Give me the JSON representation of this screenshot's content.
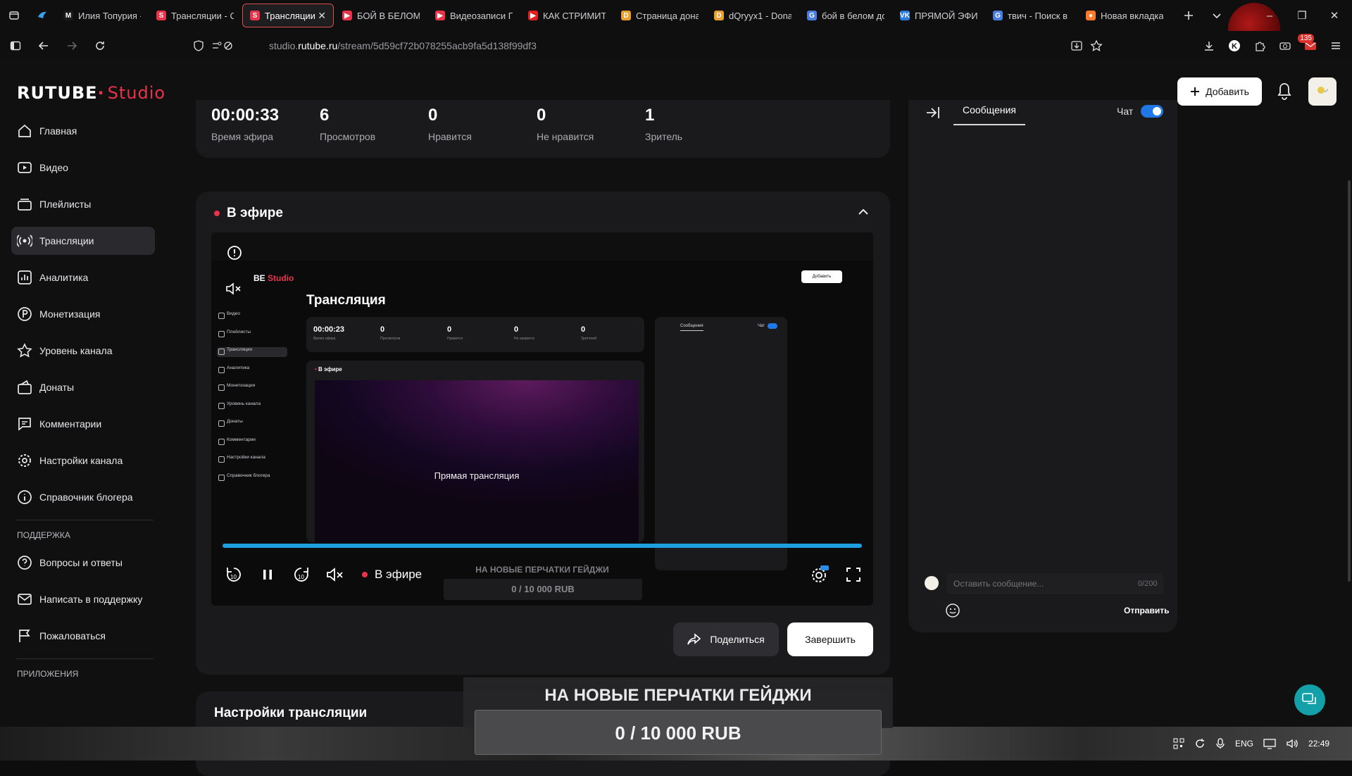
{
  "browser": {
    "tabs": [
      {
        "label": "Илия Топурия -",
        "fav": "M",
        "color": "#1a1a1a"
      },
      {
        "label": "Трансляции - С",
        "fav": "S",
        "color": "#e8334a"
      },
      {
        "label": "Трансляции -",
        "fav": "S",
        "color": "#e8334a",
        "active": true
      },
      {
        "label": "БОЙ В БЕЛОМ Д",
        "fav": "▶",
        "color": "#e8334a"
      },
      {
        "label": "Видеозаписи ПГ",
        "fav": "▶",
        "color": "#e8334a"
      },
      {
        "label": "КАК СТРИМИТЬ",
        "fav": "▶",
        "color": "#e02020"
      },
      {
        "label": "Страница донат",
        "fav": "D",
        "color": "#e8a030"
      },
      {
        "label": "dQryyx1 - Dona",
        "fav": "D",
        "color": "#e8a030"
      },
      {
        "label": "бой в белом до",
        "fav": "G",
        "color": "#4a7de0"
      },
      {
        "label": "ПРЯМОЙ ЭФИР",
        "fav": "VK",
        "color": "#2a7ae0"
      },
      {
        "label": "твич - Поиск в",
        "fav": "G",
        "color": "#4a7de0"
      },
      {
        "label": "Новая вкладка",
        "fav": "●",
        "color": "#ff7a2a"
      }
    ],
    "url_prefix": "studio.",
    "url_domain": "rutube.ru",
    "url_path": "/stream/5d59cf72b078255acb9fa5d138f99df3",
    "notif_badge": "135"
  },
  "header": {
    "logo_main": "RUTUBE",
    "logo_studio": "Studio",
    "add_label": "Добавить"
  },
  "sidebar": {
    "items": [
      {
        "label": "Главная",
        "icon": "home-icon"
      },
      {
        "label": "Видео",
        "icon": "video-icon"
      },
      {
        "label": "Плейлисты",
        "icon": "playlist-icon"
      },
      {
        "label": "Трансляции",
        "icon": "broadcast-icon",
        "active": true
      },
      {
        "label": "Аналитика",
        "icon": "analytics-icon"
      },
      {
        "label": "Монетизация",
        "icon": "monetization-icon"
      },
      {
        "label": "Уровень канала",
        "icon": "star-icon"
      },
      {
        "label": "Донаты",
        "icon": "donate-icon"
      },
      {
        "label": "Комментарии",
        "icon": "comments-icon"
      },
      {
        "label": "Настройки канала",
        "icon": "settings-icon"
      },
      {
        "label": "Справочник блогера",
        "icon": "info-icon"
      }
    ],
    "support_title": "ПОДДЕРЖКА",
    "support_items": [
      {
        "label": "Вопросы и ответы",
        "icon": "question-icon"
      },
      {
        "label": "Написать в поддержку",
        "icon": "mail-icon"
      },
      {
        "label": "Пожаловаться",
        "icon": "flag-icon"
      }
    ],
    "apps_title": "ПРИЛОЖЕНИЯ"
  },
  "stats": [
    {
      "value": "00:00:33",
      "label": "Время эфира"
    },
    {
      "value": "6",
      "label": "Просмотров"
    },
    {
      "value": "0",
      "label": "Нравится"
    },
    {
      "value": "0",
      "label": "Не нравится"
    },
    {
      "value": "1",
      "label": "Зритель"
    }
  ],
  "live": {
    "title": "В эфире",
    "player_live_label": "В эфире",
    "rewind_label": "10",
    "forward_label": "10",
    "donation_title_small": "НА НОВЫЕ ПЕРЧАТКИ ГЕЙДЖИ",
    "donation_amount_small": "0 / 10 000 RUB",
    "share_label": "Поделиться",
    "end_label": "Завершить",
    "progress": 1.0
  },
  "mini": {
    "title": "Трансляция",
    "logo_w": "BE",
    "logo_r": "Studio",
    "add": "Добавить",
    "stats": [
      {
        "value": "00:00:23",
        "label": "Время эфира"
      },
      {
        "value": "0",
        "label": "Просмотров"
      },
      {
        "value": "0",
        "label": "Нравится"
      },
      {
        "value": "0",
        "label": "Не нравится"
      },
      {
        "value": "0",
        "label": "Зрителей"
      }
    ],
    "live_title": "В эфире",
    "video_caption": "Прямая трансляция",
    "chat_tab": "Сообщения",
    "chat_toggle": "Чат",
    "side": [
      "Видео",
      "Плейлисты",
      "Трансляции",
      "Аналитика",
      "Монетизация",
      "Уровень канала",
      "Донаты",
      "Комментарии",
      "Настройки канала",
      "Справочник блогера"
    ]
  },
  "settings": {
    "title": "Настройки трансляции"
  },
  "chat": {
    "tab_label": "Сообщения",
    "toggle_label": "Чат",
    "toggle_on": true,
    "input_placeholder": "Оставить сообщение...",
    "counter": "0/200",
    "send_label": "Отправить"
  },
  "overlay": {
    "title": "НА НОВЫЕ ПЕРЧАТКИ ГЕЙДЖИ",
    "amount": "0 / 10 000 RUB"
  },
  "taskbar": {
    "lang": "ENG",
    "time": "22:49"
  }
}
